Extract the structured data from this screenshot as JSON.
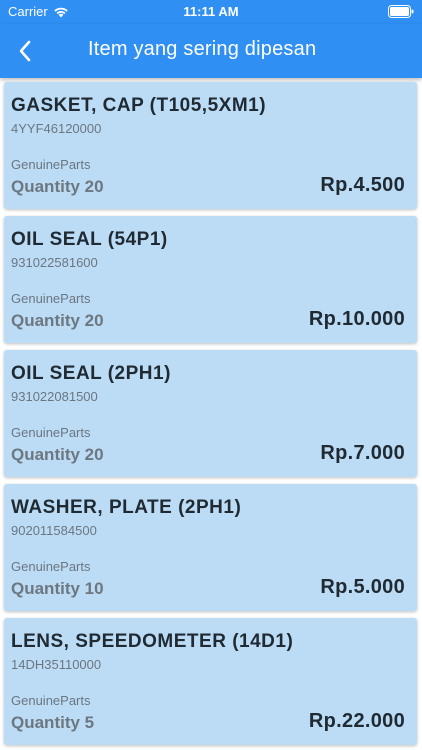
{
  "status_bar": {
    "carrier": "Carrier",
    "time": "11:11 AM"
  },
  "header": {
    "title": "Item yang sering dipesan",
    "back_icon": "chevron-left-icon"
  },
  "colors": {
    "app_bar": "#2f8ff3",
    "card_background": "#bcdcf6",
    "title_text": "#1f2a33",
    "secondary_text": "#6b7680"
  },
  "items": [
    {
      "name": "GASKET, CAP (T105,5XM1)",
      "code": "4YYF46120000",
      "brand": "GenuineParts",
      "quantity": "Quantity 20",
      "price": "Rp.4.500"
    },
    {
      "name": "OIL SEAL (54P1)",
      "code": "931022581600",
      "brand": "GenuineParts",
      "quantity": "Quantity 20",
      "price": "Rp.10.000"
    },
    {
      "name": "OIL SEAL (2PH1)",
      "code": "931022081500",
      "brand": "GenuineParts",
      "quantity": "Quantity 20",
      "price": "Rp.7.000"
    },
    {
      "name": "WASHER, PLATE (2PH1)",
      "code": "902011584500",
      "brand": "GenuineParts",
      "quantity": "Quantity 10",
      "price": "Rp.5.000"
    },
    {
      "name": "LENS, SPEEDOMETER (14D1)",
      "code": "14DH35110000",
      "brand": "GenuineParts",
      "quantity": "Quantity 5",
      "price": "Rp.22.000"
    }
  ]
}
